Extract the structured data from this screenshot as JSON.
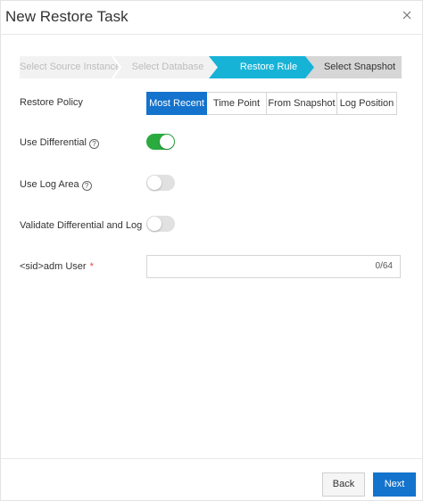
{
  "dialog": {
    "title": "New Restore Task",
    "close_icon": "close-icon"
  },
  "steps": [
    {
      "label": "Select Source Instance",
      "state": "completed"
    },
    {
      "label": "Select Database",
      "state": "completed"
    },
    {
      "label": "Restore Rule",
      "state": "current"
    },
    {
      "label": "Select Snapshot",
      "state": "upcoming"
    }
  ],
  "form": {
    "restore_policy": {
      "label": "Restore Policy",
      "options": [
        "Most Recent",
        "Time Point",
        "From Snapshot",
        "Log Position"
      ],
      "selected": "Most Recent"
    },
    "use_differential": {
      "label": "Use Differential",
      "help": "?",
      "enabled": true
    },
    "use_log_area": {
      "label": "Use Log Area",
      "help": "?",
      "enabled": false
    },
    "validate": {
      "label": "Validate Differential and Log",
      "enabled": false
    },
    "adm_user": {
      "label": "<sid>adm User",
      "required_mark": "*",
      "value": "",
      "counter": "0/64"
    }
  },
  "footer": {
    "back_label": "Back",
    "next_label": "Next"
  },
  "colors": {
    "primary": "#1473cc",
    "step_current": "#17b3d7",
    "step_upcoming": "#d6d6d6",
    "step_completed": "#f2f2f2",
    "toggle_on": "#2bab3f",
    "toggle_off": "#e1e1e1",
    "required": "#e0463b"
  }
}
